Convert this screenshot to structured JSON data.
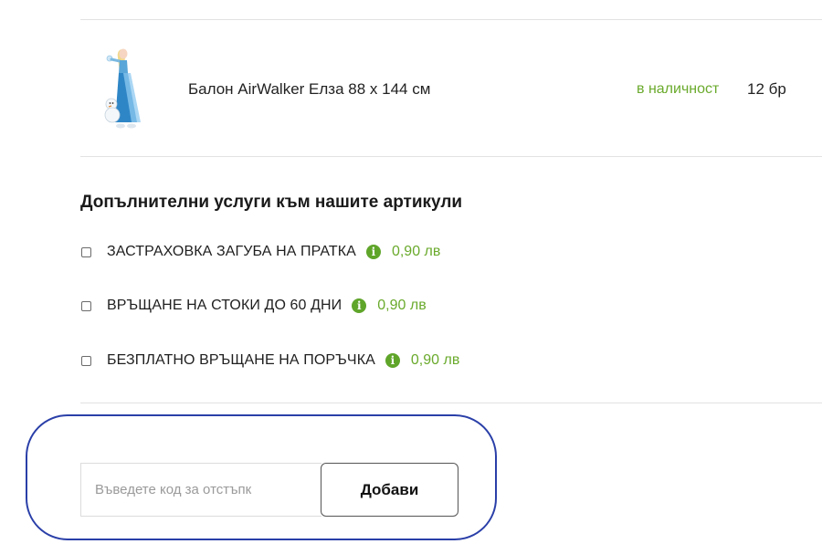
{
  "product": {
    "name": "Балон AirWalker Елза 88 x 144 см",
    "stock_status": "в наличност",
    "quantity": "12 бр",
    "thumbnail_icon": "elsa-balloon-image"
  },
  "services": {
    "title": "Допълнителни услуги към нашите артикули",
    "items": [
      {
        "label": "ЗАСТРАХОВКА ЗАГУБА НА ПРАТКА",
        "price": "0,90 лв",
        "checked": false,
        "icon": "info-icon"
      },
      {
        "label": "ВРЪЩАНЕ НА СТОКИ ДО 60 ДНИ",
        "price": "0,90 лв",
        "checked": false,
        "icon": "info-icon"
      },
      {
        "label": "БЕЗПЛАТНО ВРЪЩАНЕ НА ПОРЪЧКА",
        "price": "0,90 лв",
        "checked": false,
        "icon": "info-icon"
      }
    ]
  },
  "coupon": {
    "placeholder": "Въведете код за отстъпк",
    "value": "",
    "button_label": "Добави"
  },
  "colors": {
    "accent_green": "#6aaa2c",
    "annotation_blue": "#2a3fa8"
  }
}
